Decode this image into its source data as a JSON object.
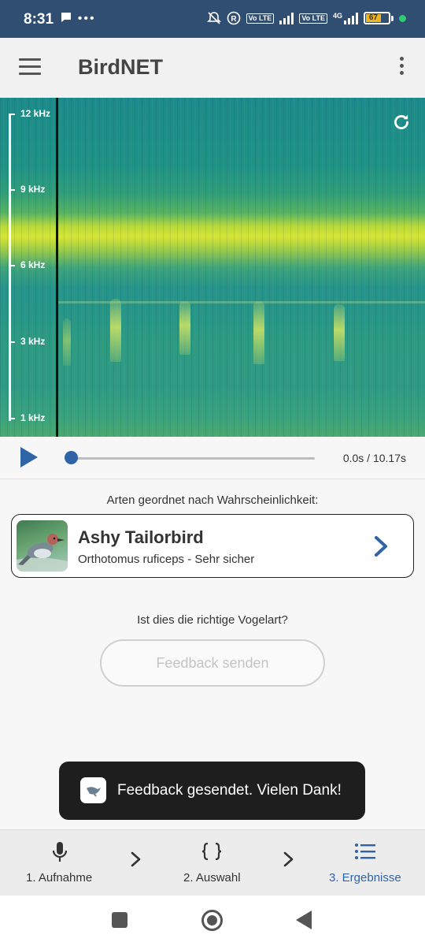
{
  "status_bar": {
    "time": "8:31",
    "left_icons": [
      "message-icon",
      "more-dots-icon"
    ],
    "right_icons": [
      "muted-bell-icon",
      "registered-icon",
      "volte-icon",
      "signal-icon",
      "volte-icon",
      "4g-signal-icon",
      "battery-icon"
    ],
    "volte_label": "Vo LTE",
    "network_label": "4G",
    "battery_level": "67",
    "battery_color": "#f2b61c",
    "dot_color": "#2ecc71"
  },
  "app_bar": {
    "title": "BirdNET",
    "menu_icon": "hamburger-icon",
    "overflow_icon": "more-vert-icon"
  },
  "spectrogram": {
    "y_labels": [
      "12 kHz",
      "9 kHz",
      "6 kHz",
      "3 kHz",
      "1 kHz"
    ],
    "refresh_icon": "refresh-icon"
  },
  "player": {
    "play_icon": "play-icon",
    "progress": 0.0,
    "time_text": "0.0s / 10.17s",
    "accent_color": "#2f64a6"
  },
  "results": {
    "heading": "Arten geordnet nach Wahrscheinlichkeit:",
    "items": [
      {
        "common_name": "Ashy Tailorbird",
        "subtitle": "Orthotomus ruficeps - Sehr sicher",
        "thumbnail_icon": "bird-photo"
      }
    ]
  },
  "feedback": {
    "question": "Ist dies die richtige Vogelart?",
    "button_label": "Feedback senden"
  },
  "toast": {
    "text": "Feedback gesendet. Vielen Dank!",
    "icon": "birdnet-app-icon"
  },
  "bottom_nav": {
    "items": [
      {
        "label": "1. Aufnahme",
        "icon": "mic-icon",
        "active": false
      },
      {
        "label": "2. Auswahl",
        "icon": "braces-icon",
        "active": false
      },
      {
        "label": "3. Ergebnisse",
        "icon": "list-icon",
        "active": true
      }
    ],
    "active_color": "#2f64a6",
    "inactive_color": "#333333"
  },
  "system_nav": {
    "buttons": [
      "recents-icon",
      "home-icon",
      "back-icon"
    ]
  }
}
